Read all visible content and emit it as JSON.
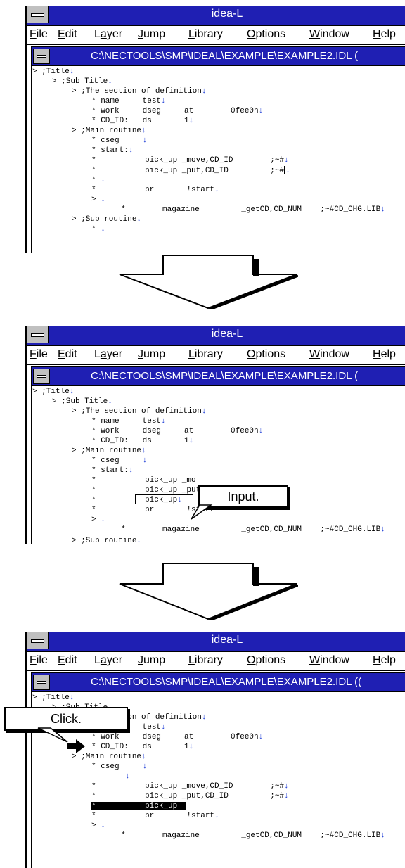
{
  "app": {
    "title": "idea-L"
  },
  "menu": [
    "File",
    "Edit",
    "Layer",
    "Jump",
    "Library",
    "Options",
    "Window",
    "Help"
  ],
  "menu_underline": [
    "F",
    "E",
    "a",
    "J",
    "L",
    "O",
    "W",
    "H"
  ],
  "document": {
    "path": "C:\\NECTOOLS\\SMP\\IDEAL\\EXAMPLE\\EXAMPLE2.IDL",
    "path_suffix_1": " (",
    "path_suffix_3": " (("
  },
  "code": {
    "title": ";Title",
    "sub_title": ";Sub Title",
    "definition": ";The section of definition",
    "name": "* name     test",
    "work": "* work     dseg     at        0fee0h",
    "cd_id": "* CD_ID:   ds       1",
    "main": ";Main routine",
    "cseg": "* cseg     ",
    "start": "* start:",
    "star": "*",
    "pick_move": "pick_up _move,CD_ID        ;~#",
    "pick_put": "pick_up _put,CD_ID         ;~#",
    "pick_move_trunc": "pick_up _mo",
    "pick_put_trunc": "pick_up _put",
    "pick_up": "pick_up",
    "br": "br       !start",
    "magazine": "magazine         _getCD,CD_NUM    ;~#CD_CHG.LIB",
    "sub_routine": ";Sub routine",
    "prompt": ">",
    "prompt_sp": "> "
  },
  "callouts": {
    "input": "Input.",
    "click": "Click."
  },
  "colors": {
    "titlebar": "#1f1fb3",
    "return_mark": "#1c3cd6"
  }
}
